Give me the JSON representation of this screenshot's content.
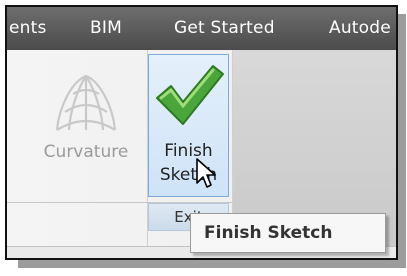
{
  "tabs": [
    "ents",
    "BIM",
    "Get Started",
    "Autode"
  ],
  "ribbon": {
    "left_fragment": "",
    "curvature_label": "Curvature",
    "finish_label_line1": "Finish",
    "finish_label_line2": "Sketch",
    "panel_label": "Exit"
  },
  "tooltip": {
    "text": "Finish Sketch"
  },
  "colors": {
    "tabbar": "#5a5a5a",
    "check": "#4aa53a",
    "highlight": "#cfe3f7"
  },
  "icons": [
    "curvature-icon",
    "checkmark-icon",
    "pointer-cursor-icon"
  ]
}
